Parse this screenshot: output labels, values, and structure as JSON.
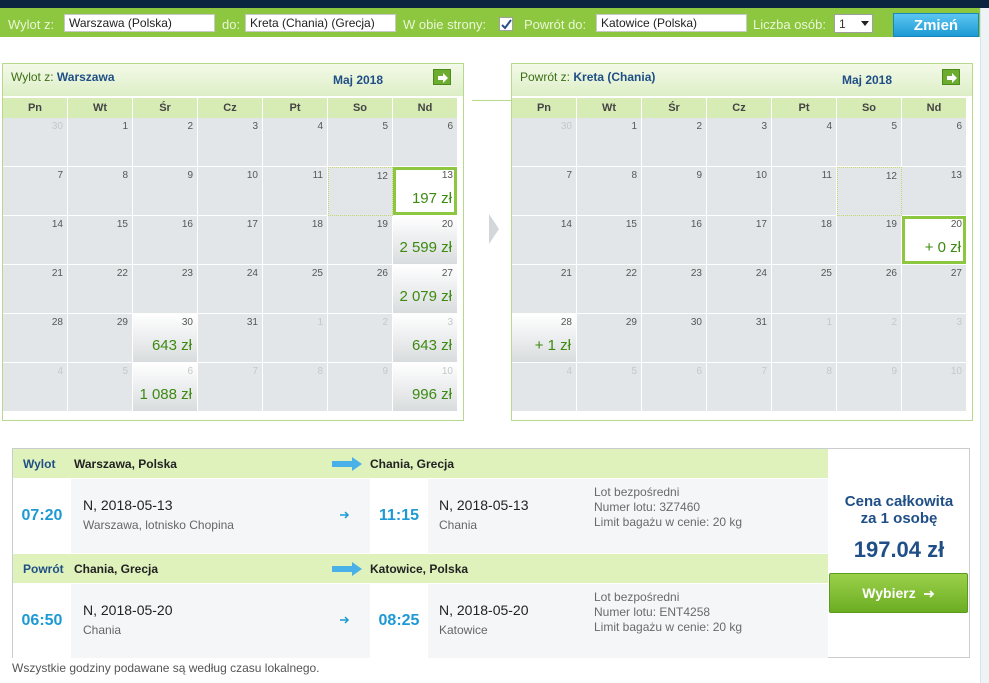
{
  "search": {
    "from_label": "Wylot z:",
    "from_value": "Warszawa (Polska)",
    "to_label": "do:",
    "to_value": "Kreta (Chania) (Grecja)",
    "roundtrip_label": "W obie strony:",
    "roundtrip_checked": true,
    "return_label": "Powrót do:",
    "return_value": "Katowice (Polska)",
    "persons_label": "Liczba osób:",
    "persons_value": "1",
    "change_button": "Zmień"
  },
  "outbound_calendar": {
    "title_prefix": "Wylot z:",
    "title_city": "Warszawa",
    "month": "Maj 2018",
    "next_icon": "arrow-right-icon",
    "weekdays": [
      "Pn",
      "Wt",
      "Śr",
      "Cz",
      "Pt",
      "So",
      "Nd"
    ],
    "days": [
      {
        "n": "30",
        "other": true
      },
      {
        "n": "1"
      },
      {
        "n": "2"
      },
      {
        "n": "3"
      },
      {
        "n": "4"
      },
      {
        "n": "5"
      },
      {
        "n": "6"
      },
      {
        "n": "7"
      },
      {
        "n": "8"
      },
      {
        "n": "9"
      },
      {
        "n": "10"
      },
      {
        "n": "11"
      },
      {
        "n": "12",
        "dotted": true
      },
      {
        "n": "13",
        "price": "197 zł",
        "selected": true
      },
      {
        "n": "14"
      },
      {
        "n": "15"
      },
      {
        "n": "16"
      },
      {
        "n": "17"
      },
      {
        "n": "18"
      },
      {
        "n": "19"
      },
      {
        "n": "20",
        "price": "2 599 zł"
      },
      {
        "n": "21"
      },
      {
        "n": "22"
      },
      {
        "n": "23"
      },
      {
        "n": "24"
      },
      {
        "n": "25"
      },
      {
        "n": "26"
      },
      {
        "n": "27",
        "price": "2 079 zł"
      },
      {
        "n": "28"
      },
      {
        "n": "29"
      },
      {
        "n": "30",
        "price": "643 zł"
      },
      {
        "n": "31"
      },
      {
        "n": "1",
        "other": true
      },
      {
        "n": "2",
        "other": true
      },
      {
        "n": "3",
        "other": true,
        "price": "643 zł"
      },
      {
        "n": "4",
        "other": true
      },
      {
        "n": "5",
        "other": true
      },
      {
        "n": "6",
        "other": true,
        "price": "1 088 zł"
      },
      {
        "n": "7",
        "other": true
      },
      {
        "n": "8",
        "other": true
      },
      {
        "n": "9",
        "other": true
      },
      {
        "n": "10",
        "other": true,
        "price": "996 zł"
      }
    ]
  },
  "return_calendar": {
    "title_prefix": "Powrót z:",
    "title_city": "Kreta (Chania)",
    "month": "Maj 2018",
    "next_icon": "arrow-right-icon",
    "weekdays": [
      "Pn",
      "Wt",
      "Śr",
      "Cz",
      "Pt",
      "So",
      "Nd"
    ],
    "days": [
      {
        "n": "30",
        "other": true
      },
      {
        "n": "1"
      },
      {
        "n": "2"
      },
      {
        "n": "3"
      },
      {
        "n": "4"
      },
      {
        "n": "5"
      },
      {
        "n": "6"
      },
      {
        "n": "7"
      },
      {
        "n": "8"
      },
      {
        "n": "9"
      },
      {
        "n": "10"
      },
      {
        "n": "11"
      },
      {
        "n": "12",
        "dotted": true
      },
      {
        "n": "13"
      },
      {
        "n": "14"
      },
      {
        "n": "15"
      },
      {
        "n": "16"
      },
      {
        "n": "17"
      },
      {
        "n": "18"
      },
      {
        "n": "19"
      },
      {
        "n": "20",
        "price": "+ 0 zł",
        "selected": true
      },
      {
        "n": "21"
      },
      {
        "n": "22"
      },
      {
        "n": "23"
      },
      {
        "n": "24"
      },
      {
        "n": "25"
      },
      {
        "n": "26"
      },
      {
        "n": "27"
      },
      {
        "n": "28",
        "price": "+ 1 zł"
      },
      {
        "n": "29"
      },
      {
        "n": "30"
      },
      {
        "n": "31"
      },
      {
        "n": "1",
        "other": true
      },
      {
        "n": "2",
        "other": true
      },
      {
        "n": "3",
        "other": true
      },
      {
        "n": "4",
        "other": true
      },
      {
        "n": "5",
        "other": true
      },
      {
        "n": "6",
        "other": true
      },
      {
        "n": "7",
        "other": true
      },
      {
        "n": "8",
        "other": true
      },
      {
        "n": "9",
        "other": true
      },
      {
        "n": "10",
        "other": true
      }
    ]
  },
  "outbound": {
    "label": "Wylot",
    "from": "Warszawa, Polska",
    "to": "Chania, Grecja",
    "dep_time": "07:20",
    "dep_date": "N, 2018-05-13",
    "dep_place": "Warszawa, lotnisko Chopina",
    "arr_time": "11:15",
    "arr_date": "N, 2018-05-13",
    "arr_place": "Chania",
    "info1": "Lot bezpośredni",
    "info2": "Numer lotu: 3Z7460",
    "info3": "Limit bagażu w cenie: 20 kg"
  },
  "inbound": {
    "label": "Powrót",
    "from": "Chania, Grecja",
    "to": "Katowice, Polska",
    "dep_time": "06:50",
    "dep_date": "N, 2018-05-20",
    "dep_place": "Chania",
    "arr_time": "08:25",
    "arr_date": "N, 2018-05-20",
    "arr_place": "Katowice",
    "info1": "Lot bezpośredni",
    "info2": "Numer lotu: ENT4258",
    "info3": "Limit bagażu w cenie: 20 kg"
  },
  "price": {
    "label_line1": "Cena całkowita",
    "label_line2": "za 1 osobę",
    "value": "197.04 zł",
    "select_button": "Wybierz"
  },
  "footnote": "Wszystkie godziny podawane są według czasu lokalnego.",
  "colors": {
    "accent_green": "#8dc63f",
    "price_green": "#3c8a10",
    "time_blue": "#1d9ad4",
    "header_blue": "#1f4f86"
  }
}
